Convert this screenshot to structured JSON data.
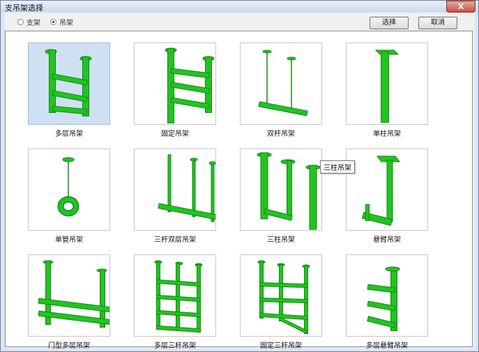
{
  "window": {
    "title": "支吊架选择",
    "close_label": "X"
  },
  "radios": [
    {
      "label": "支架",
      "checked": false
    },
    {
      "label": "吊架",
      "checked": true
    }
  ],
  "buttons": {
    "ok": "选择",
    "cancel": "取消"
  },
  "items": [
    {
      "label": "多层吊架",
      "icon": "multi-layer-hanger-icon",
      "selected": true
    },
    {
      "label": "固定吊架",
      "icon": "fixed-hanger-icon",
      "selected": false
    },
    {
      "label": "双杆吊架",
      "icon": "double-rod-hanger-icon",
      "selected": false
    },
    {
      "label": "单柱吊架",
      "icon": "single-column-hanger-icon",
      "selected": false
    },
    {
      "label": "单管吊架",
      "icon": "single-pipe-hanger-icon",
      "selected": false
    },
    {
      "label": "三杆双层吊架",
      "icon": "three-rod-double-layer-hanger-icon",
      "selected": false
    },
    {
      "label": "三柱吊架",
      "icon": "three-column-hanger-icon",
      "selected": false
    },
    {
      "label": "悬臂吊架",
      "icon": "cantilever-hanger-icon",
      "selected": false
    },
    {
      "label": "门型多层吊架",
      "icon": "portal-multi-layer-hanger-icon",
      "selected": false
    },
    {
      "label": "多层三杆吊架",
      "icon": "multi-layer-three-rod-hanger-icon",
      "selected": false
    },
    {
      "label": "固定三杆吊架",
      "icon": "fixed-three-rod-hanger-icon",
      "selected": false
    },
    {
      "label": "多层悬臂吊架",
      "icon": "multi-layer-cantilever-hanger-icon",
      "selected": false
    }
  ],
  "tooltip": "三柱吊架",
  "colors": {
    "steel": "#22c322",
    "steel_dark": "#138a13",
    "selection": "#cfe0f3"
  }
}
